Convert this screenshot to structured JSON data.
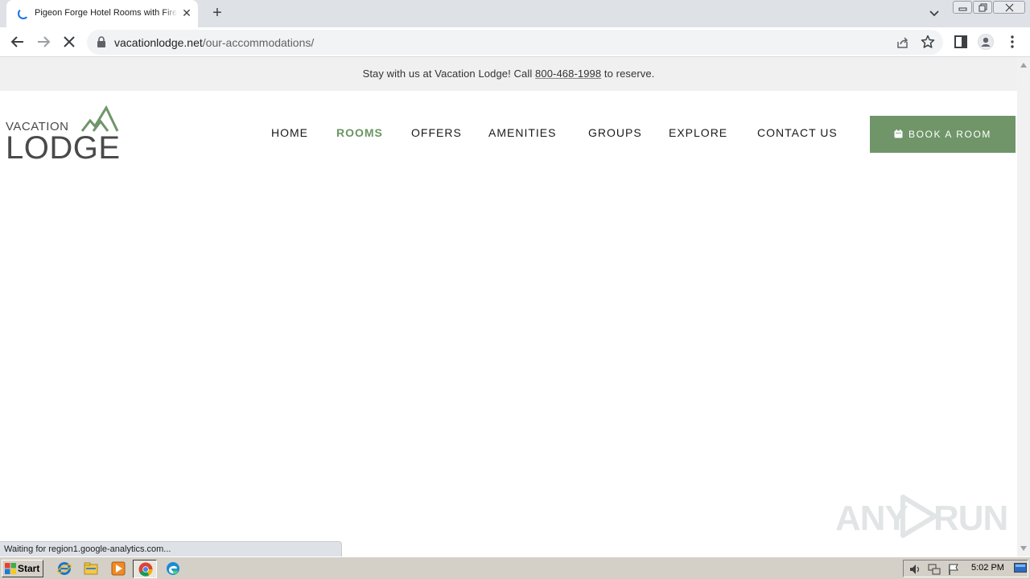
{
  "browser": {
    "tab_title": "Pigeon Forge Hotel Rooms with Fireplaces",
    "url_domain": "vacationlodge.net",
    "url_path": "/our-accommodations/",
    "status_text": "Waiting for region1.google-analytics.com..."
  },
  "site": {
    "announcement_prefix": "Stay with us at Vacation Lodge! Call ",
    "announcement_phone": "800-468-1998",
    "announcement_suffix": " to reserve.",
    "logo_top": "VACATION",
    "logo_bottom": "LODGE",
    "nav": [
      {
        "label": "HOME",
        "active": false
      },
      {
        "label": "ROOMS",
        "active": true
      },
      {
        "label": "OFFERS",
        "active": false
      },
      {
        "label": "AMENITIES",
        "active": false
      },
      {
        "label": "GROUPS",
        "active": false
      },
      {
        "label": "EXPLORE",
        "active": false
      },
      {
        "label": "CONTACT US",
        "active": false
      }
    ],
    "book_button": "BOOK A ROOM",
    "accent_color": "#6f9568"
  },
  "watermark": {
    "left": "ANY",
    "right": "RUN"
  },
  "taskbar": {
    "start_label": "Start",
    "clock": "5:02 PM"
  }
}
